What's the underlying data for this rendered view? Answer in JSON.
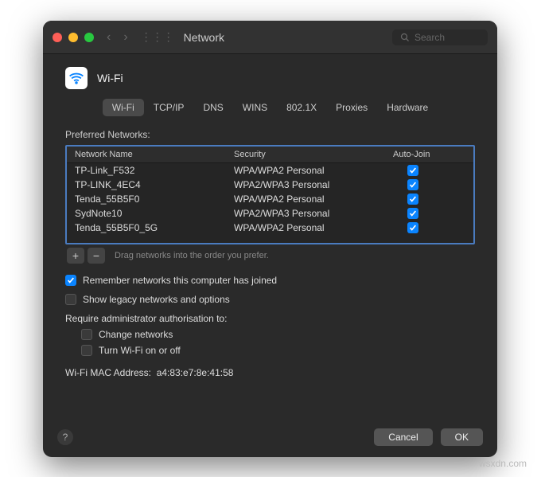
{
  "window": {
    "title": "Network",
    "search_placeholder": "Search"
  },
  "header": {
    "title": "Wi-Fi"
  },
  "tabs": [
    {
      "label": "Wi-Fi",
      "active": true
    },
    {
      "label": "TCP/IP",
      "active": false
    },
    {
      "label": "DNS",
      "active": false
    },
    {
      "label": "WINS",
      "active": false
    },
    {
      "label": "802.1X",
      "active": false
    },
    {
      "label": "Proxies",
      "active": false
    },
    {
      "label": "Hardware",
      "active": false
    }
  ],
  "table": {
    "title": "Preferred Networks:",
    "headers": {
      "name": "Network Name",
      "security": "Security",
      "autojoin": "Auto-Join"
    },
    "rows": [
      {
        "name": "TP-Link_F532",
        "security": "WPA/WPA2 Personal",
        "autojoin": true
      },
      {
        "name": "TP-LINK_4EC4",
        "security": "WPA2/WPA3 Personal",
        "autojoin": true
      },
      {
        "name": "Tenda_55B5F0",
        "security": "WPA/WPA2 Personal",
        "autojoin": true
      },
      {
        "name": "SydNote10",
        "security": "WPA2/WPA3 Personal",
        "autojoin": true
      },
      {
        "name": "Tenda_55B5F0_5G",
        "security": "WPA/WPA2 Personal",
        "autojoin": true
      }
    ],
    "hint": "Drag networks into the order you prefer."
  },
  "options": {
    "remember": {
      "label": "Remember networks this computer has joined",
      "checked": true
    },
    "legacy": {
      "label": "Show legacy networks and options",
      "checked": false
    },
    "require_label": "Require administrator authorisation to:",
    "change_networks": {
      "label": "Change networks",
      "checked": false
    },
    "turn_wifi": {
      "label": "Turn Wi-Fi on or off",
      "checked": false
    }
  },
  "mac": {
    "label": "Wi-Fi MAC Address:",
    "value": "a4:83:e7:8e:41:58"
  },
  "buttons": {
    "cancel": "Cancel",
    "ok": "OK"
  },
  "watermark": "wsxdn.com"
}
